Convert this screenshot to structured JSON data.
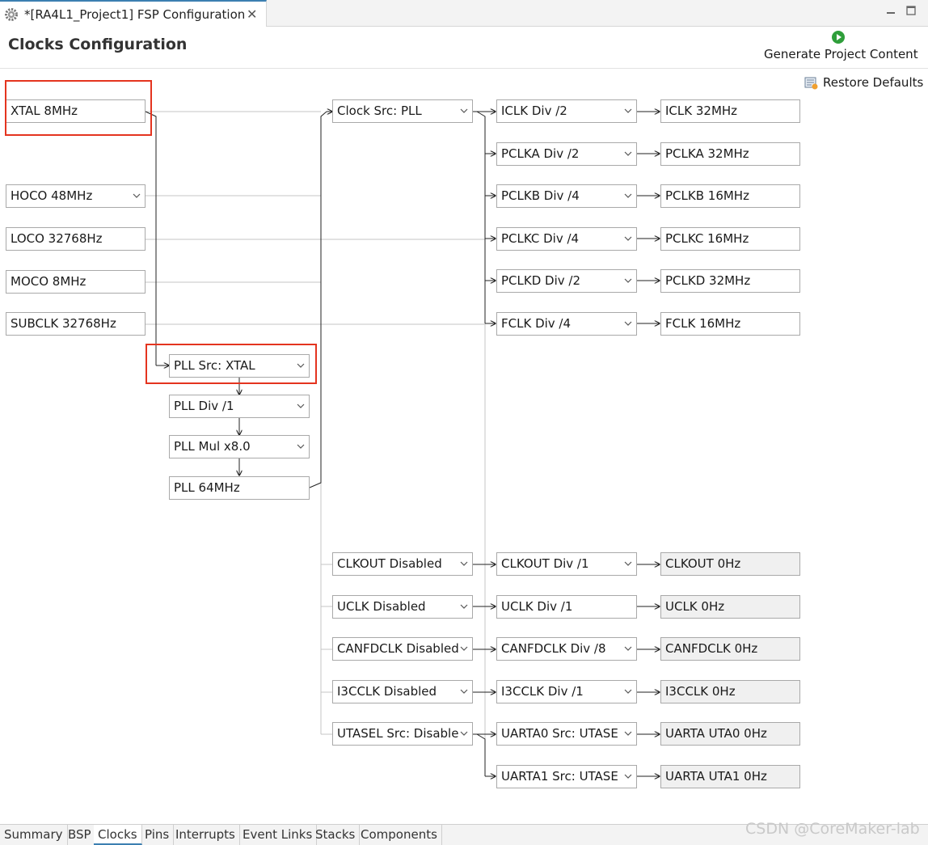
{
  "editor_tab": {
    "title": "*[RA4L1_Project1] FSP Configuration",
    "close": "✕"
  },
  "header": {
    "title": "Clocks Configuration",
    "generate_label": "Generate Project Content",
    "restore_label": "Restore Defaults"
  },
  "sources": {
    "xtal": "XTAL 8MHz",
    "hoco": "HOCO 48MHz",
    "loco": "LOCO 32768Hz",
    "moco": "MOCO 8MHz",
    "subclk": "SUBCLK 32768Hz"
  },
  "pll": {
    "src": "PLL Src: XTAL",
    "div": "PLL Div /1",
    "mul": "PLL Mul x8.0",
    "out": "PLL 64MHz"
  },
  "clock_src": "Clock Src: PLL",
  "dividers": {
    "iclk": "ICLK Div /2",
    "pclka": "PCLKA Div /2",
    "pclkb": "PCLKB Div /4",
    "pclkc": "PCLKC Div /4",
    "pclkd": "PCLKD Div /2",
    "fclk": "FCLK Div /4"
  },
  "outputs": {
    "iclk": "ICLK 32MHz",
    "pclka": "PCLKA 32MHz",
    "pclkb": "PCLKB 16MHz",
    "pclkc": "PCLKC 16MHz",
    "pclkd": "PCLKD 32MHz",
    "fclk": "FCLK 16MHz"
  },
  "peripheral_src": {
    "clkout": "CLKOUT Disabled",
    "uclk": "UCLK Disabled",
    "canfdclk": "CANFDCLK Disabled",
    "i3cclk": "I3CCLK Disabled",
    "utasel": "UTASEL Src: Disable"
  },
  "peripheral_div": {
    "clkout": "CLKOUT Div /1",
    "uclk": "UCLK Div /1",
    "canfdclk": "CANFDCLK Div /8",
    "i3cclk": "I3CCLK Div /1",
    "uarta0": "UARTA0 Src: UTASE",
    "uarta1": "UARTA1 Src: UTASE"
  },
  "peripheral_out": {
    "clkout": "CLKOUT 0Hz",
    "uclk": "UCLK 0Hz",
    "canfdclk": "CANFDCLK 0Hz",
    "i3cclk": "I3CCLK 0Hz",
    "uarta0": "UARTA UTA0 0Hz",
    "uarta1": "UARTA UTA1 0Hz"
  },
  "bottom_tabs": [
    "Summary",
    "BSP",
    "Clocks",
    "Pins",
    "Interrupts",
    "Event Links",
    "Stacks",
    "Components"
  ],
  "watermark": "CSDN @CoreMaker-lab",
  "colors": {
    "highlight": "#e4341f",
    "active_tab": "#3c7fb1",
    "run_icon": "#2e9e3a"
  }
}
